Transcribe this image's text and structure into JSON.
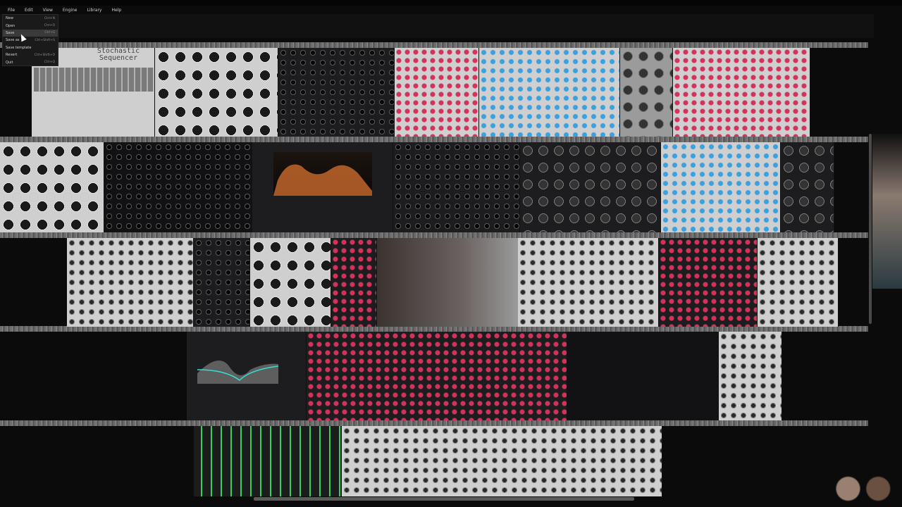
{
  "menu": {
    "items": [
      "File",
      "Edit",
      "View",
      "Engine",
      "Library",
      "Help"
    ]
  },
  "file_menu": {
    "items": [
      {
        "label": "New",
        "shortcut": "Ctrl+N"
      },
      {
        "label": "Open",
        "shortcut": "Ctrl+O"
      },
      {
        "label": "Save",
        "shortcut": "Ctrl+S"
      },
      {
        "label": "Save as",
        "shortcut": "Ctrl+Shift+S"
      },
      {
        "label": "Save template",
        "shortcut": ""
      },
      {
        "label": "Revert",
        "shortcut": "Ctrl+Shift+O"
      },
      {
        "label": "Quit",
        "shortcut": "Ctrl+Q"
      }
    ],
    "highlighted_index": 2
  },
  "modules": {
    "stochastic_title": "Stochastic\nSequencer"
  },
  "colors": {
    "accent_red": "#d3335a",
    "accent_blue": "#3aa0e0",
    "accent_green": "#35e08a",
    "accent_orange": "#d7782a"
  }
}
